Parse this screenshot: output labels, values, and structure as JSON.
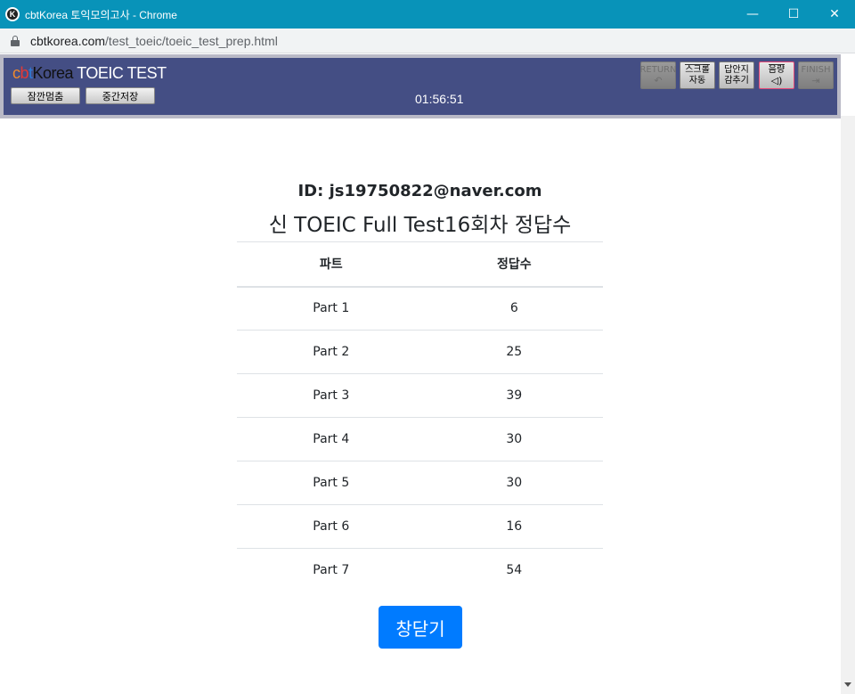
{
  "window": {
    "title": "cbtKorea 토익모의고사 - Chrome",
    "controls": {
      "minimize": "—",
      "maximize": "☐",
      "close": "✕"
    }
  },
  "address": {
    "host": "cbtkorea.com",
    "path": "/test_toeic/toeic_test_prep.html"
  },
  "toolbar": {
    "logo_c": "c",
    "logo_b": "b",
    "logo_t": "t",
    "logo_korea": "Korea",
    "logo_suffix": " TOEIC TEST",
    "pause_label": "잠깐멈춤",
    "save_label": "중간저장",
    "timer": "01:56:51",
    "return_label": "RETURN",
    "return_icon": "↶",
    "scroll_line1": "스크롤",
    "scroll_line2": "자동",
    "answer_line1": "답안지",
    "answer_line2": "감추기",
    "volume_label": "음량",
    "volume_icon": "◁)",
    "finish_label": "FINISH",
    "finish_icon": "⇥"
  },
  "result": {
    "user_id": "ID: js19750822@naver.com",
    "title": "신 TOEIC Full Test16회차 정답수",
    "headers": {
      "part": "파트",
      "correct": "정답수"
    },
    "rows": [
      {
        "part": "Part 1",
        "correct": "6"
      },
      {
        "part": "Part 2",
        "correct": "25"
      },
      {
        "part": "Part 3",
        "correct": "39"
      },
      {
        "part": "Part 4",
        "correct": "30"
      },
      {
        "part": "Part 5",
        "correct": "30"
      },
      {
        "part": "Part 6",
        "correct": "16"
      },
      {
        "part": "Part 7",
        "correct": "54"
      }
    ],
    "close_label": "창닫기"
  }
}
